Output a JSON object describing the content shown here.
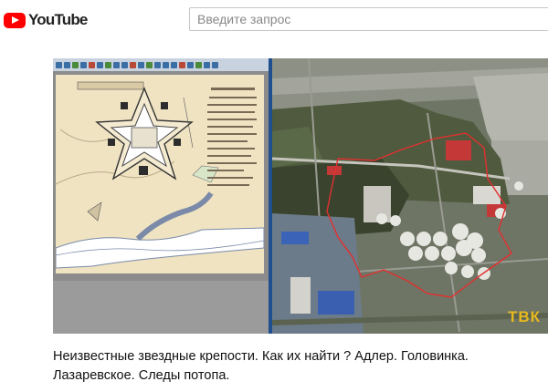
{
  "header": {
    "logo_text": "YouTube",
    "search_placeholder": "Введите запрос"
  },
  "video": {
    "watermark": "ТВК"
  },
  "title_line1": "Неизвестные звездные крепости. Как их найти ? Адлер. Головинка.",
  "title_line2": "Лазаревское. Следы потопа."
}
